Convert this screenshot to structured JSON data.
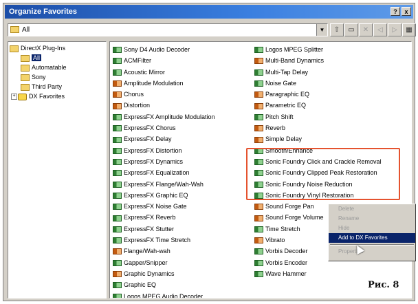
{
  "window": {
    "title": "Organize Favorites",
    "title_buttons": [
      "?",
      "x"
    ]
  },
  "toolbar": {
    "folder_combo_value": "All",
    "buttons": [
      "folder-up",
      "new-folder",
      "delete",
      "back",
      "forward",
      "views"
    ]
  },
  "tree": {
    "root": "DirectX Plug-Ins",
    "children": [
      "All",
      "Automatable",
      "Sony",
      "Third Party"
    ],
    "favorites": "DX Favorites",
    "selected": "All"
  },
  "plugins": {
    "column1": [
      {
        "label": "Sony D4 Audio Decoder",
        "icon": "green-plugin-icon"
      },
      {
        "label": "ACMFilter",
        "icon": "green-plugin-icon"
      },
      {
        "label": "Acoustic Mirror",
        "icon": "green-plugin-icon"
      },
      {
        "label": "Amplitude Modulation",
        "icon": "orange-plugin-icon"
      },
      {
        "label": "Chorus",
        "icon": "orange-plugin-icon"
      },
      {
        "label": "Distortion",
        "icon": "orange-plugin-icon"
      },
      {
        "label": "ExpressFX Amplitude Modulation",
        "icon": "green-plugin-icon"
      },
      {
        "label": "ExpressFX Chorus",
        "icon": "green-plugin-icon"
      },
      {
        "label": "ExpressFX Delay",
        "icon": "green-plugin-icon"
      },
      {
        "label": "ExpressFX Distortion",
        "icon": "green-plugin-icon"
      },
      {
        "label": "ExpressFX Dynamics",
        "icon": "green-plugin-icon"
      },
      {
        "label": "ExpressFX Equalization",
        "icon": "green-plugin-icon"
      },
      {
        "label": "ExpressFX Flange/Wah-Wah",
        "icon": "green-plugin-icon"
      },
      {
        "label": "ExpressFX Graphic EQ",
        "icon": "green-plugin-icon"
      },
      {
        "label": "ExpressFX Noise Gate",
        "icon": "green-plugin-icon"
      },
      {
        "label": "ExpressFX Reverb",
        "icon": "green-plugin-icon"
      },
      {
        "label": "ExpressFX Stutter",
        "icon": "green-plugin-icon"
      },
      {
        "label": "ExpressFX Time Stretch",
        "icon": "green-plugin-icon"
      },
      {
        "label": "Flange/Wah-wah",
        "icon": "orange-plugin-icon"
      },
      {
        "label": "Gapper/Snipper",
        "icon": "green-plugin-icon"
      },
      {
        "label": "Graphic Dynamics",
        "icon": "orange-plugin-icon"
      },
      {
        "label": "Graphic EQ",
        "icon": "green-plugin-icon"
      },
      {
        "label": "Logos MPEG Audio Decoder",
        "icon": "green-plugin-icon"
      }
    ],
    "column2": [
      {
        "label": "Logos MPEG Splitter",
        "icon": "green-plugin-icon"
      },
      {
        "label": "Multi-Band Dynamics",
        "icon": "orange-plugin-icon"
      },
      {
        "label": "Multi-Tap Delay",
        "icon": "green-plugin-icon"
      },
      {
        "label": "Noise Gate",
        "icon": "green-plugin-icon"
      },
      {
        "label": "Paragraphic EQ",
        "icon": "orange-plugin-icon"
      },
      {
        "label": "Parametric EQ",
        "icon": "orange-plugin-icon"
      },
      {
        "label": "Pitch Shift",
        "icon": "green-plugin-icon"
      },
      {
        "label": "Reverb",
        "icon": "orange-plugin-icon"
      },
      {
        "label": "Simple Delay",
        "icon": "orange-plugin-icon"
      },
      {
        "label": "Smooth/Enhance",
        "icon": "green-plugin-icon"
      },
      {
        "label": "Sonic Foundry Click and Crackle Removal",
        "icon": "green-plugin-icon"
      },
      {
        "label": "Sonic Foundry Clipped Peak Restoration",
        "icon": "green-plugin-icon"
      },
      {
        "label": "Sonic Foundry Noise Reduction",
        "icon": "green-plugin-icon"
      },
      {
        "label": "Sonic Foundry Vinyl Restoration",
        "icon": "green-plugin-icon"
      },
      {
        "label": "Sound Forge Pan",
        "icon": "orange-plugin-icon"
      },
      {
        "label": "Sound Forge Volume",
        "icon": "orange-plugin-icon"
      },
      {
        "label": "Time Stretch",
        "icon": "green-plugin-icon"
      },
      {
        "label": "Vibrato",
        "icon": "orange-plugin-icon"
      },
      {
        "label": "Vorbis Decoder",
        "icon": "green-plugin-icon"
      },
      {
        "label": "Vorbis Encoder",
        "icon": "green-plugin-icon"
      },
      {
        "label": "Wave Hammer",
        "icon": "green-plugin-icon"
      }
    ]
  },
  "context_menu": {
    "items": [
      "Delete",
      "Rename",
      "Hide",
      "Add to DX Favorites",
      "Properties"
    ],
    "active": "Add to DX Favorites"
  },
  "caption": "Рис. 8",
  "colors": {
    "title_bar": "#1c4ea8",
    "highlight_border": "#e5532f",
    "selection": "#0a246a"
  }
}
